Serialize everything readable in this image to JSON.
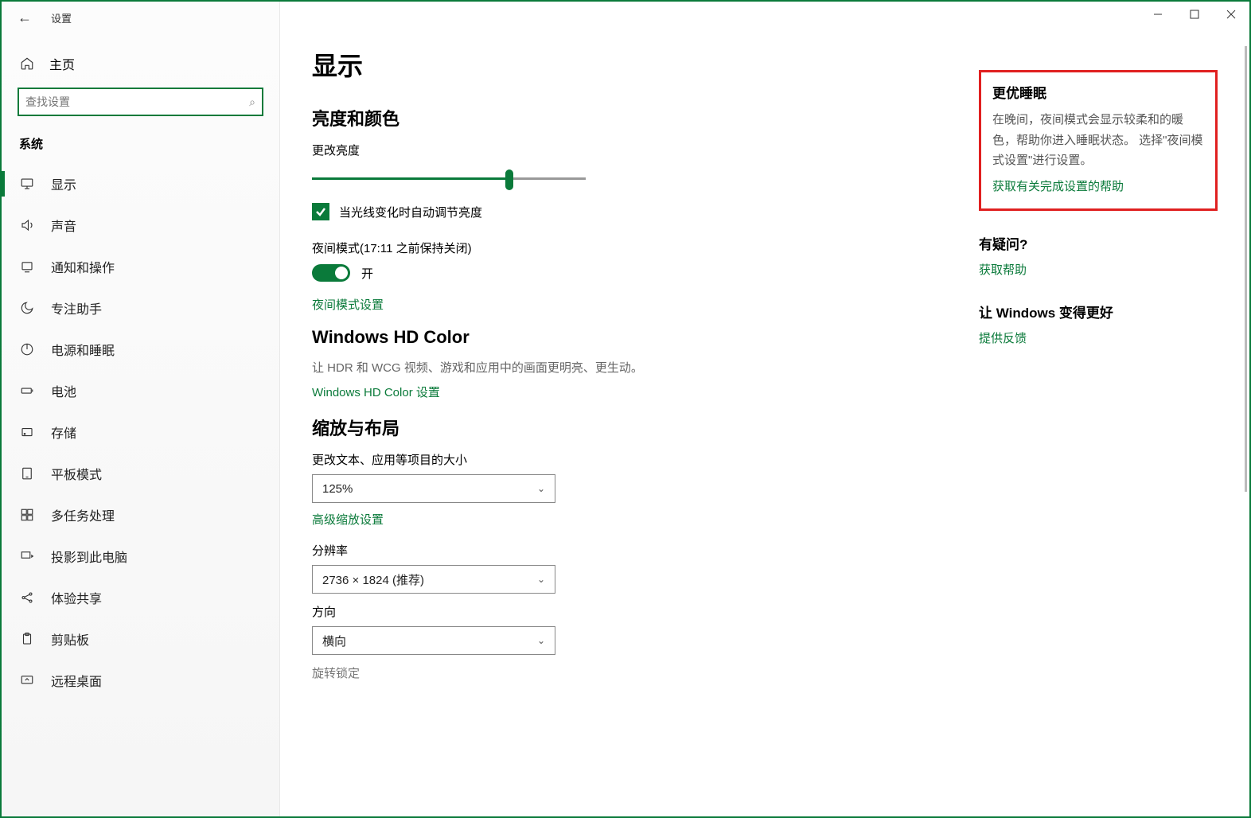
{
  "window": {
    "title": "设置"
  },
  "sidebar": {
    "home": "主页",
    "search_placeholder": "查找设置",
    "category": "系统",
    "items": [
      {
        "label": "显示",
        "icon": "monitor",
        "active": true
      },
      {
        "label": "声音",
        "icon": "sound"
      },
      {
        "label": "通知和操作",
        "icon": "notify"
      },
      {
        "label": "专注助手",
        "icon": "moon"
      },
      {
        "label": "电源和睡眠",
        "icon": "power"
      },
      {
        "label": "电池",
        "icon": "battery"
      },
      {
        "label": "存储",
        "icon": "storage"
      },
      {
        "label": "平板模式",
        "icon": "tablet"
      },
      {
        "label": "多任务处理",
        "icon": "multitask"
      },
      {
        "label": "投影到此电脑",
        "icon": "project"
      },
      {
        "label": "体验共享",
        "icon": "share"
      },
      {
        "label": "剪贴板",
        "icon": "clipboard"
      },
      {
        "label": "远程桌面",
        "icon": "remote"
      }
    ]
  },
  "main": {
    "page_title": "显示",
    "brightness": {
      "section": "亮度和颜色",
      "label": "更改亮度",
      "slider_percent": 72,
      "auto_label": "当光线变化时自动调节亮度"
    },
    "night": {
      "label": "夜间模式(17:11 之前保持关闭)",
      "toggle_label": "开",
      "settings_link": "夜间模式设置"
    },
    "hd": {
      "section": "Windows HD Color",
      "desc": "让 HDR 和 WCG 视频、游戏和应用中的画面更明亮、更生动。",
      "link": "Windows HD Color 设置"
    },
    "scale": {
      "section": "缩放与布局",
      "size_label": "更改文本、应用等项目的大小",
      "size_value": "125%",
      "advanced_link": "高级缩放设置",
      "resolution_label": "分辨率",
      "resolution_value": "2736 × 1824 (推荐)",
      "orientation_label": "方向",
      "orientation_value": "横向",
      "rotation_label": "旋转锁定"
    }
  },
  "aside": {
    "sleep": {
      "title": "更优睡眠",
      "desc": "在晚间，夜间模式会显示较柔和的暖色，帮助你进入睡眠状态。 选择\"夜间模式设置\"进行设置。",
      "link": "获取有关完成设置的帮助"
    },
    "help": {
      "title": "有疑问?",
      "link": "获取帮助"
    },
    "feedback": {
      "title": "让 Windows 变得更好",
      "link": "提供反馈"
    }
  }
}
